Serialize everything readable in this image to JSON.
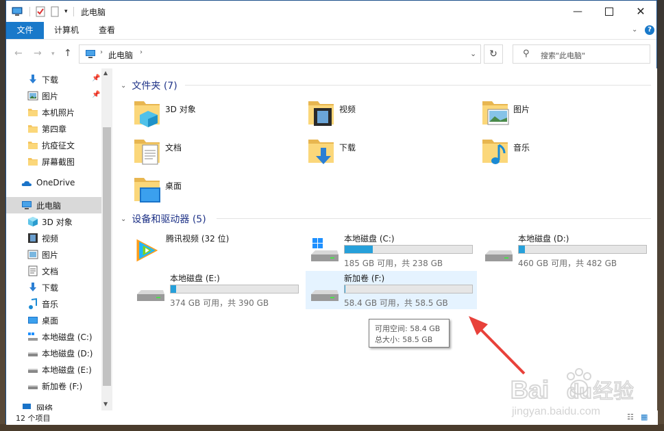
{
  "window": {
    "title": "此电脑",
    "controls": [
      "minimize-icon",
      "maximize-icon",
      "close-icon"
    ]
  },
  "ribbon": {
    "tabs": [
      "文件",
      "计算机",
      "查看"
    ],
    "help": "?"
  },
  "address": {
    "path": "此电脑",
    "search_placeholder": "搜索\"此电脑\""
  },
  "sidebar": {
    "items": [
      {
        "label": "下载",
        "icon": "download-icon",
        "pinned": true
      },
      {
        "label": "图片",
        "icon": "pictures-icon",
        "pinned": true
      },
      {
        "label": "本机照片",
        "icon": "folder-icon"
      },
      {
        "label": "第四章",
        "icon": "folder-icon"
      },
      {
        "label": "抗疫征文",
        "icon": "folder-icon"
      },
      {
        "label": "屏幕截图",
        "icon": "folder-icon"
      },
      {
        "label": "OneDrive",
        "icon": "onedrive-icon"
      },
      {
        "label": "此电脑",
        "icon": "computer-icon",
        "selected": true
      },
      {
        "label": "3D 对象",
        "icon": "3d-objects-icon"
      },
      {
        "label": "视频",
        "icon": "video-icon"
      },
      {
        "label": "图片",
        "icon": "pictures-icon"
      },
      {
        "label": "文档",
        "icon": "documents-icon"
      },
      {
        "label": "下载",
        "icon": "download-icon"
      },
      {
        "label": "音乐",
        "icon": "music-icon"
      },
      {
        "label": "桌面",
        "icon": "desktop-icon"
      },
      {
        "label": "本地磁盘 (C:)",
        "icon": "windows-drive-icon"
      },
      {
        "label": "本地磁盘 (D:)",
        "icon": "drive-icon"
      },
      {
        "label": "本地磁盘 (E:)",
        "icon": "drive-icon"
      },
      {
        "label": "新加卷 (F:)",
        "icon": "drive-icon"
      },
      {
        "label": "网络",
        "icon": "network-icon"
      }
    ]
  },
  "folders_group": {
    "title": "文件夹 (7)",
    "items": [
      {
        "name": "3D 对象",
        "icon": "3d-objects-folder-icon"
      },
      {
        "name": "视频",
        "icon": "video-folder-icon"
      },
      {
        "name": "图片",
        "icon": "pictures-folder-icon"
      },
      {
        "name": "文档",
        "icon": "documents-folder-icon"
      },
      {
        "name": "下载",
        "icon": "download-folder-icon"
      },
      {
        "name": "音乐",
        "icon": "music-folder-icon"
      },
      {
        "name": "桌面",
        "icon": "desktop-folder-icon"
      }
    ]
  },
  "drives_group": {
    "title": "设备和驱动器 (5)",
    "items": [
      {
        "name": "腾讯视频 (32 位)",
        "icon": "tencent-video-icon"
      },
      {
        "name": "本地磁盘 (C:)",
        "free": "185 GB 可用，共 238 GB",
        "used_fraction": 0.223,
        "icon": "windows-drive-icon"
      },
      {
        "name": "本地磁盘 (D:)",
        "free": "460 GB 可用，共 482 GB",
        "used_fraction": 0.046,
        "icon": "drive-icon"
      },
      {
        "name": "本地磁盘 (E:)",
        "free": "374 GB 可用，共 390 GB",
        "used_fraction": 0.041,
        "icon": "drive-icon"
      },
      {
        "name": "新加卷 (F:)",
        "free": "58.4 GB 可用，共 58.5 GB",
        "used_fraction": 0.002,
        "icon": "drive-icon",
        "hovered": true
      }
    ]
  },
  "tooltip": {
    "line1": "可用空间: 58.4 GB",
    "line2": "总大小: 58.5 GB"
  },
  "status": {
    "count": "12 个项目"
  },
  "watermark": {
    "brand": "Bai",
    "brand2": "du",
    "cn": "经验",
    "url": "jingyan.baidu.com"
  },
  "colors": {
    "accent": "#1979ca",
    "drive_bar": "#26a0da",
    "group_title": "#1e3287",
    "selection": "#d9d9d9",
    "hover": "#e5f3ff",
    "arrow": "#e8413a"
  }
}
